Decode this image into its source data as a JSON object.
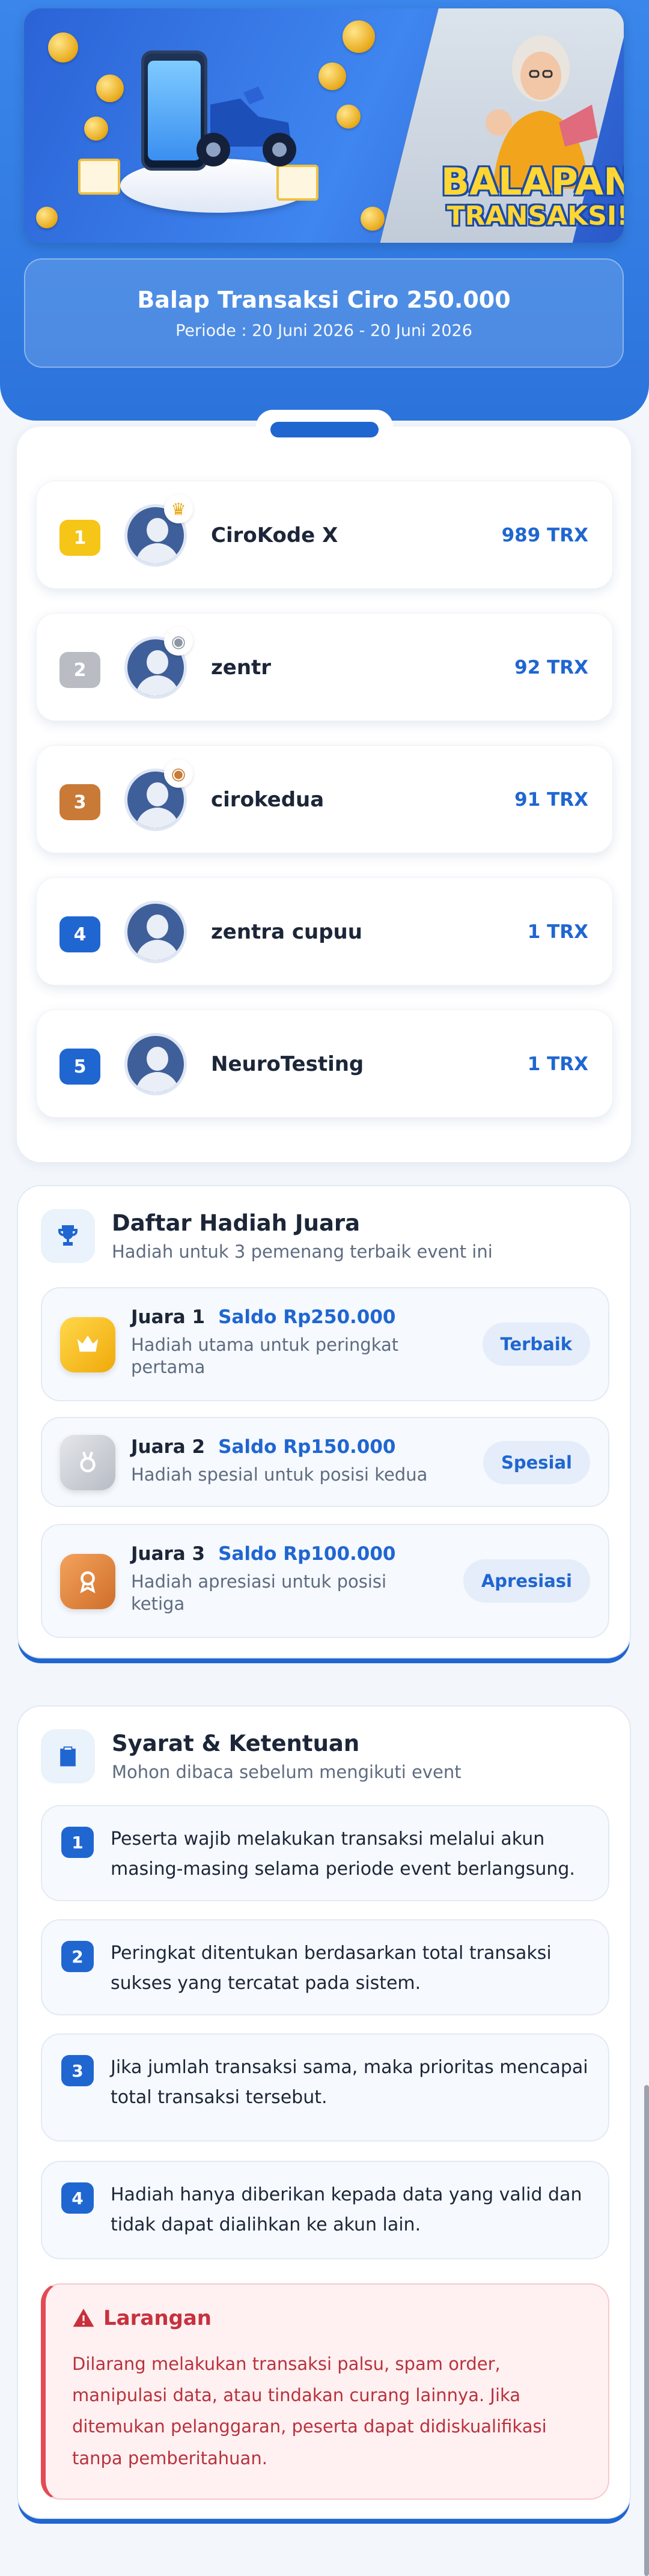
{
  "banner": {
    "title_line1": "BALAPAN",
    "title_line2": "TRANSAKSI!"
  },
  "period": {
    "title": "Balap Transaksi Ciro 250.000",
    "subtitle": "Periode : 20 Juni 2026 - 20 Juni 2026"
  },
  "leaderboard": [
    {
      "rank": "1",
      "name": "CiroKode X",
      "score": "989 TRX",
      "badge_color": "#f5c518",
      "medal": "crown"
    },
    {
      "rank": "2",
      "name": "zentr",
      "score": "92 TRX",
      "badge_color": "#b9bcc2",
      "medal": "silver-medal"
    },
    {
      "rank": "3",
      "name": "cirokedua",
      "score": "91 TRX",
      "badge_color": "#c97a36",
      "medal": "bronze-medal"
    },
    {
      "rank": "4",
      "name": "zentra cupuu",
      "score": "1 TRX",
      "badge_color": "#1f66d1",
      "medal": ""
    },
    {
      "rank": "5",
      "name": "NeuroTesting",
      "score": "1 TRX",
      "badge_color": "#1f66d1",
      "medal": ""
    }
  ],
  "prizes": {
    "title": "Daftar Hadiah Juara",
    "subtitle": "Hadiah untuk 3 pemenang terbaik event ini",
    "items": [
      {
        "label": "Juara 1",
        "amount": "Saldo Rp250.000",
        "desc": "Hadiah utama untuk peringkat pertama",
        "tag": "Terbaik",
        "icon": "crown-icon"
      },
      {
        "label": "Juara 2",
        "amount": "Saldo Rp150.000",
        "desc": "Hadiah spesial untuk posisi kedua",
        "tag": "Spesial",
        "icon": "medal-icon"
      },
      {
        "label": "Juara 3",
        "amount": "Saldo Rp100.000",
        "desc": "Hadiah apresiasi untuk posisi ketiga",
        "tag": "Apresiasi",
        "icon": "award-icon"
      }
    ]
  },
  "terms": {
    "title": "Syarat & Ketentuan",
    "subtitle": "Mohon dibaca sebelum mengikuti event",
    "rules": [
      {
        "num": "1",
        "text": "Peserta wajib melakukan transaksi melalui akun masing-masing selama periode event berlangsung."
      },
      {
        "num": "2",
        "text": "Peringkat ditentukan berdasarkan total transaksi sukses yang tercatat pada sistem."
      },
      {
        "num": "3",
        "text": "Jika jumlah transaksi sama, maka prioritas mencapai total transaksi tersebut."
      },
      {
        "num": "4",
        "text": "Hadiah hanya diberikan kepada data yang valid dan tidak dapat dialihkan ke akun lain."
      }
    ],
    "warning_title": "Larangan",
    "warning_text": "Dilarang melakukan transaksi palsu, spam order, manipulasi data, atau tindakan curang lainnya. Jika ditemukan pelanggaran, peserta dapat didiskualifikasi tanpa pemberitahuan."
  },
  "colors": {
    "primary": "#1f66d1",
    "hero": "#2c74dc",
    "warning": "#c7313d"
  }
}
